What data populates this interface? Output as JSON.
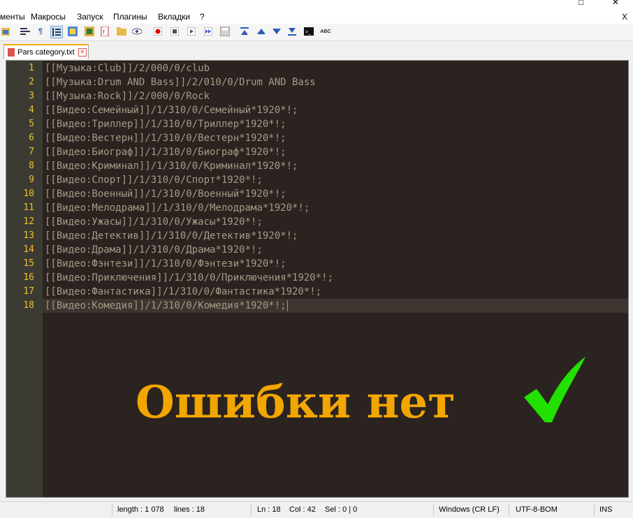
{
  "window": {
    "controls": [
      "□",
      "✕"
    ]
  },
  "menu": {
    "items": [
      "менты",
      "Макросы",
      "Запуск",
      "Плагины",
      "Вкладки",
      "?"
    ],
    "close": "X"
  },
  "tab": {
    "label": "Pars category.txt"
  },
  "editor": {
    "lines": [
      {
        "n": "1",
        "t": "[[Музыка:Club]]/2/000/0/club"
      },
      {
        "n": "2",
        "t": "[[Музыка:Drum AND Bass]]/2/010/0/Drum AND Bass"
      },
      {
        "n": "3",
        "t": "[[Музыка:Rock]]/2/000/0/Rock"
      },
      {
        "n": "4",
        "t": "[[Видео:Семейный]]/1/310/0/Семейный*1920*!;"
      },
      {
        "n": "5",
        "t": "[[Видео:Триллер]]/1/310/0/Триллер*1920*!;"
      },
      {
        "n": "6",
        "t": "[[Видео:Вестерн]]/1/310/0/Вестерн*1920*!;"
      },
      {
        "n": "7",
        "t": "[[Видео:Биограф]]/1/310/0/Биограф*1920*!;"
      },
      {
        "n": "8",
        "t": "[[Видео:Криминал]]/1/310/0/Криминал*1920*!;"
      },
      {
        "n": "9",
        "t": "[[Видео:Спорт]]/1/310/0/Спорт*1920*!;"
      },
      {
        "n": "10",
        "t": "[[Видео:Военный]]/1/310/0/Военный*1920*!;"
      },
      {
        "n": "11",
        "t": "[[Видео:Мелодрама]]/1/310/0/Мелодрама*1920*!;"
      },
      {
        "n": "12",
        "t": "[[Видео:Ужасы]]/1/310/0/Ужасы*1920*!;"
      },
      {
        "n": "13",
        "t": "[[Видео:Детектив]]/1/310/0/Детектив*1920*!;"
      },
      {
        "n": "14",
        "t": "[[Видео:Драма]]/1/310/0/Драма*1920*!;"
      },
      {
        "n": "15",
        "t": "[[Видео:Фэнтези]]/1/310/0/Фэнтези*1920*!;"
      },
      {
        "n": "16",
        "t": "[[Видео:Приключения]]/1/310/0/Приключения*1920*!;"
      },
      {
        "n": "17",
        "t": "[[Видео:Фантастика]]/1/310/0/Фантастика*1920*!;"
      },
      {
        "n": "18",
        "t": "[[Видео:Комедия]]/1/310/0/Комедия*1920*!;"
      }
    ],
    "current_line": 18
  },
  "overlay": {
    "text": "Ошибки нет",
    "color": "#f2a600",
    "check_color": "#22e000"
  },
  "status": {
    "length": "length : 1 078",
    "lines": "lines : 18",
    "ln": "Ln : 18",
    "col": "Col : 42",
    "sel": "Sel : 0 | 0",
    "eol": "Windows (CR LF)",
    "encoding": "UTF-8-BOM",
    "mode": "INS"
  }
}
